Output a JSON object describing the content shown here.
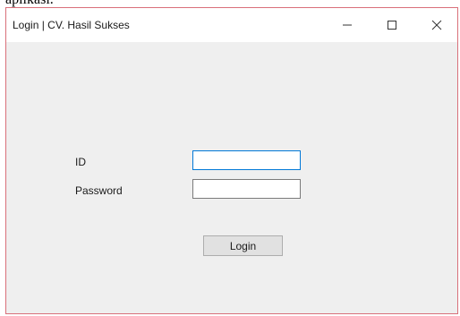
{
  "background_caption": "aplikasi.",
  "window": {
    "title": "Login | CV. Hasil Sukses",
    "controls": [
      "minimize-icon",
      "maximize-icon",
      "close-icon"
    ]
  },
  "form": {
    "id_label": "ID",
    "id_value": "",
    "password_label": "Password",
    "password_value": "",
    "login_button": "Login"
  },
  "colors": {
    "window_border": "#d9707a",
    "focus_border": "#0078d7",
    "client_bg": "#efefef"
  }
}
